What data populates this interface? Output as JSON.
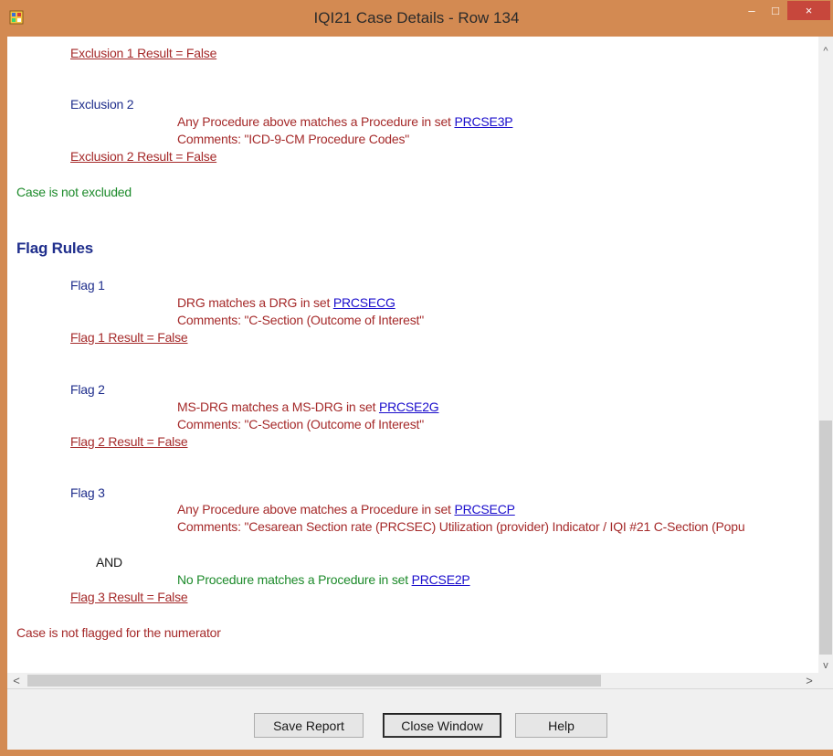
{
  "window": {
    "title": "IQI21 Case Details - Row 134",
    "minimize_glyph": "–",
    "maximize_glyph": "□",
    "close_glyph": "×",
    "accent_color": "#d38a52"
  },
  "report": {
    "exclusion1_result": "Exclusion 1 Result = False",
    "exclusion2_label": "Exclusion 2",
    "exclusion2_rule_prefix": "Any Procedure above matches a Procedure in set ",
    "exclusion2_rule_set": "PRCSE3P",
    "exclusion2_comments": "Comments: \"ICD-9-CM Procedure Codes\"",
    "exclusion2_result": "Exclusion 2 Result = False",
    "exclusion_summary": "Case is not excluded",
    "flag_rules_heading": "Flag Rules",
    "flag1_label": "Flag 1",
    "flag1_rule_prefix": "DRG matches a DRG in set ",
    "flag1_rule_set": "PRCSECG",
    "flag1_comments": "Comments: \"C-Section (Outcome of Interest\"",
    "flag1_result": "Flag 1 Result = False",
    "flag2_label": "Flag 2",
    "flag2_rule_prefix": "MS-DRG matches a MS-DRG in set ",
    "flag2_rule_set": "PRCSE2G",
    "flag2_comments": "Comments: \"C-Section (Outcome of Interest\"",
    "flag2_result": "Flag 2 Result = False",
    "flag3_label": "Flag 3",
    "flag3_rule_prefix": "Any Procedure above matches a Procedure in set ",
    "flag3_rule_set": "PRCSECP",
    "flag3_comments": "Comments: \"Cesarean Section rate (PRCSEC) Utilization (provider) Indicator / IQI #21 C-Section (Popu",
    "flag3_and": "AND",
    "flag3_rule2_prefix": "No Procedure matches a Procedure in set ",
    "flag3_rule2_set": "PRCSE2P",
    "flag3_result": "Flag 3 Result = False",
    "flag_summary": "Case is not flagged for the numerator"
  },
  "scrollbars": {
    "up_glyph": "^",
    "down_glyph": "v",
    "left_glyph": "<",
    "right_glyph": ">"
  },
  "buttons": {
    "save_report": "Save Report",
    "close_window": "Close Window",
    "help": "Help"
  }
}
